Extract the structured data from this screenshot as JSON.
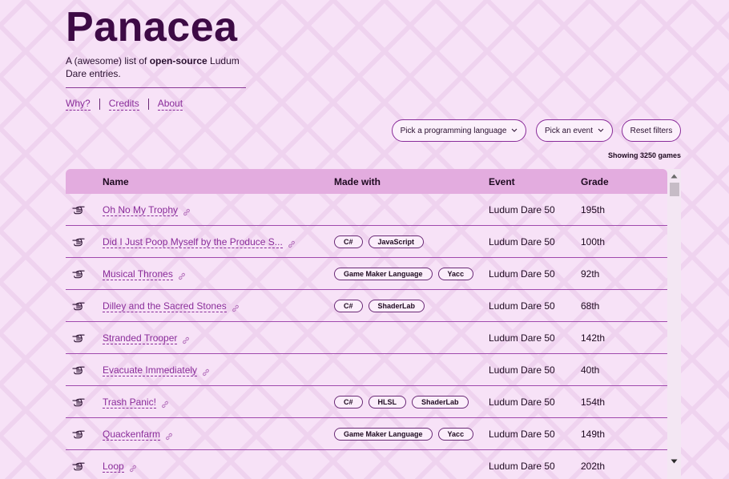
{
  "site": {
    "title": "Panacea",
    "tagline_prefix": "A (awesome) list of ",
    "tagline_bold": "open-source",
    "tagline_suffix": " Ludum Dare entries."
  },
  "nav": {
    "items": [
      {
        "label": "Why?"
      },
      {
        "label": "Credits"
      },
      {
        "label": "About"
      }
    ]
  },
  "filters": {
    "language_label": "Pick a programming language",
    "event_label": "Pick an event",
    "reset_label": "Reset filters"
  },
  "showing_text": "Showing 3250 games",
  "table": {
    "columns": {
      "name": "Name",
      "made_with": "Made with",
      "event": "Event",
      "grade": "Grade"
    },
    "rows": [
      {
        "name": "Oh No My Trophy",
        "languages": [],
        "event": "Ludum Dare 50",
        "grade": "195th"
      },
      {
        "name": "Did I Just Poop Myself by the Produce S...",
        "languages": [
          "C#",
          "JavaScript"
        ],
        "event": "Ludum Dare 50",
        "grade": "100th"
      },
      {
        "name": "Musical Thrones",
        "languages": [
          "Game Maker Language",
          "Yacc"
        ],
        "event": "Ludum Dare 50",
        "grade": "92th"
      },
      {
        "name": "Dilley and the Sacred Stones",
        "languages": [
          "C#",
          "ShaderLab"
        ],
        "event": "Ludum Dare 50",
        "grade": "68th"
      },
      {
        "name": "Stranded Trooper",
        "languages": [],
        "event": "Ludum Dare 50",
        "grade": "142th"
      },
      {
        "name": "Evacuate Immediately",
        "languages": [],
        "event": "Ludum Dare 50",
        "grade": "40th"
      },
      {
        "name": "Trash Panic!",
        "languages": [
          "C#",
          "HLSL",
          "ShaderLab"
        ],
        "event": "Ludum Dare 50",
        "grade": "154th"
      },
      {
        "name": "Quackenfarm",
        "languages": [
          "Game Maker Language",
          "Yacc"
        ],
        "event": "Ludum Dare 50",
        "grade": "149th"
      },
      {
        "name": "Loop",
        "languages": [],
        "event": "Ludum Dare 50",
        "grade": "202th"
      }
    ]
  },
  "icons": {
    "row_icon": "pointing-hand-icon",
    "link_icon": "link-icon",
    "dropdown_icon": "chevron-down-icon"
  },
  "colors": {
    "background": "#f7e2f7",
    "title": "#3d0a45",
    "accent": "#8a2d9a",
    "header_bg": "#e3acdf"
  }
}
